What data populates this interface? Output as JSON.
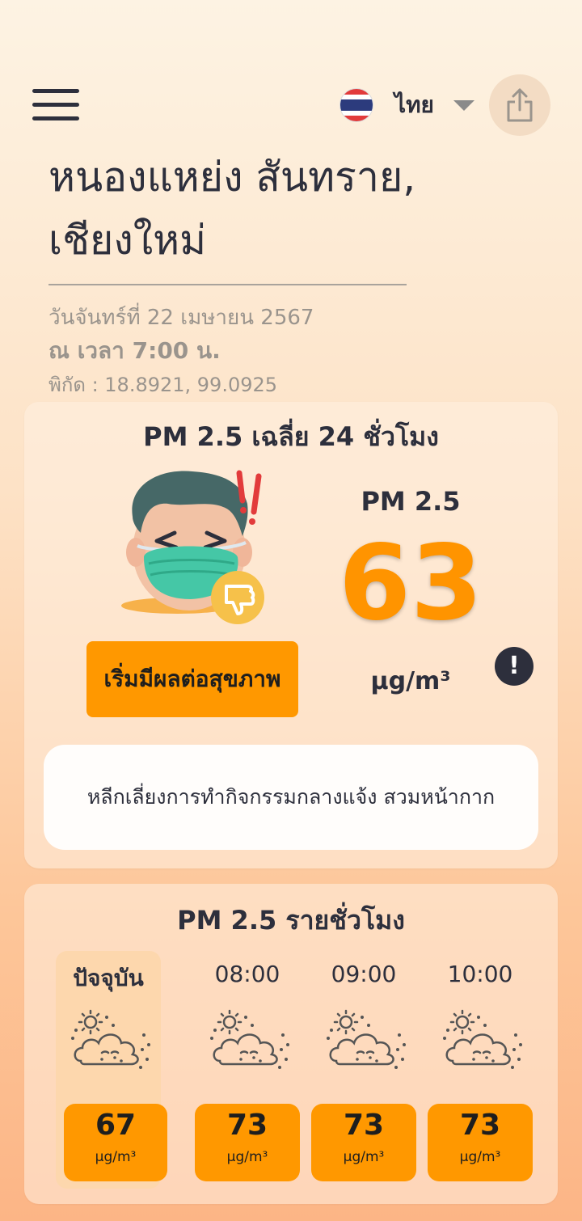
{
  "header": {
    "language": "ไทย",
    "menu_icon": "hamburger-menu-icon",
    "flag_icon": "thailand-flag-icon",
    "share_icon": "share-icon"
  },
  "location": {
    "line1": "หนองแหย่ง สันทราย,",
    "line2": "เชียงใหม่",
    "date": "วันจันทร์ที่ 22 เมษายน 2567",
    "time": "ณ เวลา 7:00 น.",
    "coordinates": "พิกัด : 18.8921, 99.0925"
  },
  "daily": {
    "title": "PM 2.5 เฉลี่ย 24 ชั่วโมง",
    "status": "เริ่มมีผลต่อสุขภาพ",
    "pm_label": "PM 2.5",
    "value": "63",
    "unit": "μg/m³",
    "info_symbol": "!",
    "advice": "หลีกเลี่ยงการทำกิจกรรมกลางแจ้ง สวมหน้ากาก",
    "accent_color": "#ff9800",
    "avatar_icon": "masked-face-thumbs-down-icon"
  },
  "hourly": {
    "title": "PM 2.5 รายชั่วโมง",
    "items": [
      {
        "label": "ปัจจุบัน",
        "value": "67",
        "unit": "μg/m³",
        "icon": "sun-cloud-dust-icon"
      },
      {
        "label": "08:00",
        "value": "73",
        "unit": "μg/m³",
        "icon": "sun-cloud-dust-icon"
      },
      {
        "label": "09:00",
        "value": "73",
        "unit": "μg/m³",
        "icon": "sun-cloud-dust-icon"
      },
      {
        "label": "10:00",
        "value": "73",
        "unit": "μg/m³",
        "icon": "sun-cloud-dust-icon"
      }
    ]
  }
}
